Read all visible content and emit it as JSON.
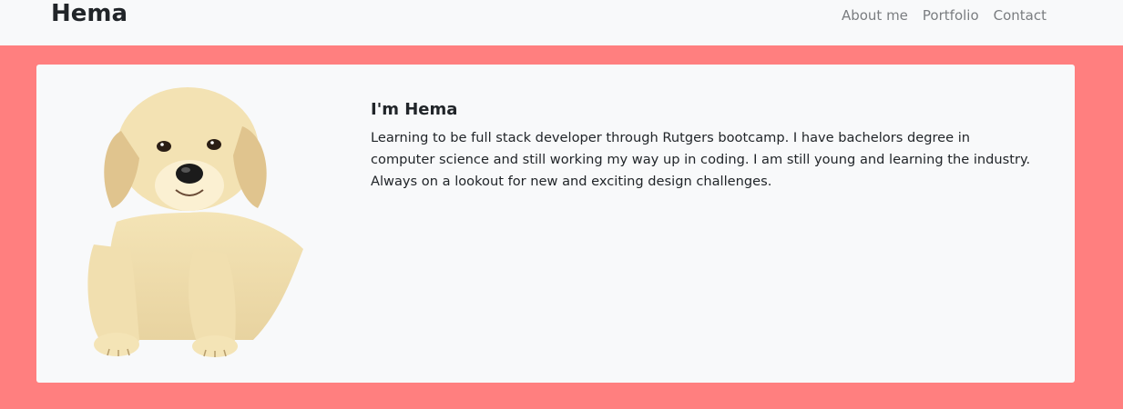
{
  "navbar": {
    "brand": "Hema",
    "links": [
      "About me",
      "Portfolio",
      "Contact"
    ]
  },
  "about": {
    "title": "I'm Hema",
    "bio": "Learning to be full stack developer through Rutgers bootcamp. I have bachelors degree in computer science and still working my way up in coding. I am still young and learning the industry. Always on a lookout for new and exciting design challenges.",
    "photo_subject": "golden-retriever-puppy"
  },
  "colors": {
    "page_background": "#ff7f7f",
    "navbar_background": "#f8f9fa",
    "card_background": "#f8f9fa",
    "text": "#212529",
    "nav_link": "#7a7d80"
  }
}
